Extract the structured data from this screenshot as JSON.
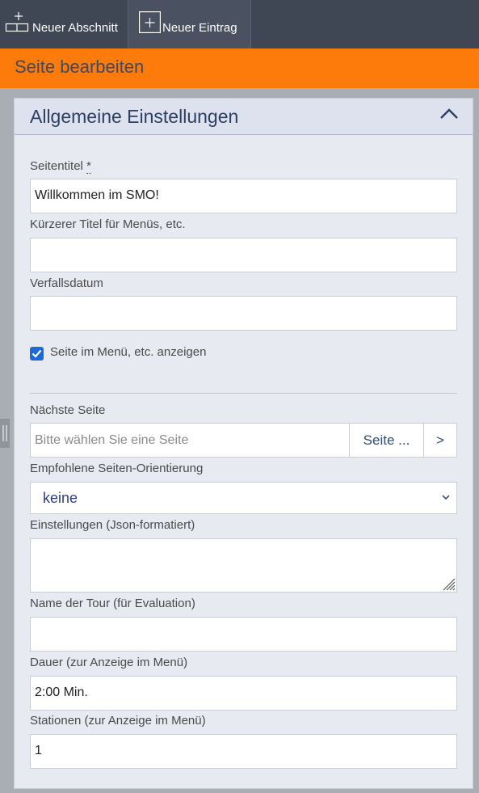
{
  "toolbar": {
    "new_section_label": "Neuer Abschnitt",
    "new_entry_label": "Neuer Eintrag"
  },
  "page_header": {
    "title": "Seite bearbeiten"
  },
  "panel": {
    "title": "Allgemeine Einstellungen",
    "fields": {
      "page_title": {
        "label": "Seitentitel",
        "required_marker": "*",
        "value": "Willkommen im SMO!"
      },
      "short_title": {
        "label": "Kürzerer Titel für Menüs, etc.",
        "value": ""
      },
      "expiry_date": {
        "label": "Verfallsdatum",
        "value": ""
      },
      "show_in_menu": {
        "label": "Seite im Menü, etc. anzeigen",
        "checked": true
      },
      "next_page": {
        "label": "Nächste Seite",
        "placeholder": "Bitte wählen Sie eine Seite",
        "choose_button": "Seite ...",
        "go_button": ">"
      },
      "orientation": {
        "label": "Empfohlene Seiten-Orientierung",
        "selected": "keine"
      },
      "settings_json": {
        "label": "Einstellungen (Json-formatiert)",
        "value": ""
      },
      "tour_name": {
        "label": "Name der Tour (für Evaluation)",
        "value": ""
      },
      "duration": {
        "label": "Dauer (zur Anzeige im Menü)",
        "value": "2:00 Min."
      },
      "stations": {
        "label": "Stationen (zur Anzeige im Menü)",
        "value": "1"
      }
    }
  },
  "colors": {
    "toolbar_bg": "#3f4654",
    "accent_orange": "#fd7b0a",
    "panel_bg": "#e7eaf1",
    "title_blue": "#2d3e63",
    "checkbox_blue": "#1c6ad8"
  }
}
